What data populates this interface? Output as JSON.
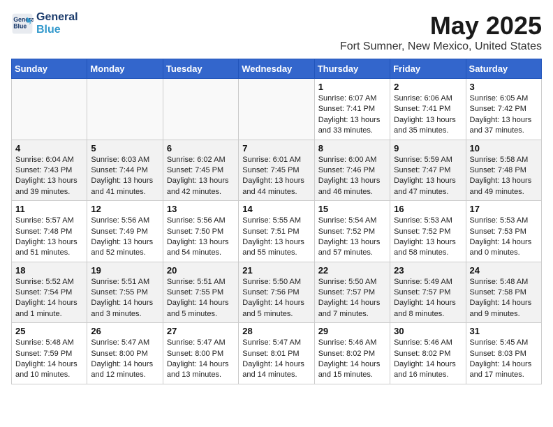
{
  "header": {
    "logo_line1": "General",
    "logo_line2": "Blue",
    "month": "May 2025",
    "location": "Fort Sumner, New Mexico, United States"
  },
  "weekdays": [
    "Sunday",
    "Monday",
    "Tuesday",
    "Wednesday",
    "Thursday",
    "Friday",
    "Saturday"
  ],
  "weeks": [
    [
      {
        "day": "",
        "info": ""
      },
      {
        "day": "",
        "info": ""
      },
      {
        "day": "",
        "info": ""
      },
      {
        "day": "",
        "info": ""
      },
      {
        "day": "1",
        "info": "Sunrise: 6:07 AM\nSunset: 7:41 PM\nDaylight: 13 hours\nand 33 minutes."
      },
      {
        "day": "2",
        "info": "Sunrise: 6:06 AM\nSunset: 7:41 PM\nDaylight: 13 hours\nand 35 minutes."
      },
      {
        "day": "3",
        "info": "Sunrise: 6:05 AM\nSunset: 7:42 PM\nDaylight: 13 hours\nand 37 minutes."
      }
    ],
    [
      {
        "day": "4",
        "info": "Sunrise: 6:04 AM\nSunset: 7:43 PM\nDaylight: 13 hours\nand 39 minutes."
      },
      {
        "day": "5",
        "info": "Sunrise: 6:03 AM\nSunset: 7:44 PM\nDaylight: 13 hours\nand 41 minutes."
      },
      {
        "day": "6",
        "info": "Sunrise: 6:02 AM\nSunset: 7:45 PM\nDaylight: 13 hours\nand 42 minutes."
      },
      {
        "day": "7",
        "info": "Sunrise: 6:01 AM\nSunset: 7:45 PM\nDaylight: 13 hours\nand 44 minutes."
      },
      {
        "day": "8",
        "info": "Sunrise: 6:00 AM\nSunset: 7:46 PM\nDaylight: 13 hours\nand 46 minutes."
      },
      {
        "day": "9",
        "info": "Sunrise: 5:59 AM\nSunset: 7:47 PM\nDaylight: 13 hours\nand 47 minutes."
      },
      {
        "day": "10",
        "info": "Sunrise: 5:58 AM\nSunset: 7:48 PM\nDaylight: 13 hours\nand 49 minutes."
      }
    ],
    [
      {
        "day": "11",
        "info": "Sunrise: 5:57 AM\nSunset: 7:48 PM\nDaylight: 13 hours\nand 51 minutes."
      },
      {
        "day": "12",
        "info": "Sunrise: 5:56 AM\nSunset: 7:49 PM\nDaylight: 13 hours\nand 52 minutes."
      },
      {
        "day": "13",
        "info": "Sunrise: 5:56 AM\nSunset: 7:50 PM\nDaylight: 13 hours\nand 54 minutes."
      },
      {
        "day": "14",
        "info": "Sunrise: 5:55 AM\nSunset: 7:51 PM\nDaylight: 13 hours\nand 55 minutes."
      },
      {
        "day": "15",
        "info": "Sunrise: 5:54 AM\nSunset: 7:52 PM\nDaylight: 13 hours\nand 57 minutes."
      },
      {
        "day": "16",
        "info": "Sunrise: 5:53 AM\nSunset: 7:52 PM\nDaylight: 13 hours\nand 58 minutes."
      },
      {
        "day": "17",
        "info": "Sunrise: 5:53 AM\nSunset: 7:53 PM\nDaylight: 14 hours\nand 0 minutes."
      }
    ],
    [
      {
        "day": "18",
        "info": "Sunrise: 5:52 AM\nSunset: 7:54 PM\nDaylight: 14 hours\nand 1 minute."
      },
      {
        "day": "19",
        "info": "Sunrise: 5:51 AM\nSunset: 7:55 PM\nDaylight: 14 hours\nand 3 minutes."
      },
      {
        "day": "20",
        "info": "Sunrise: 5:51 AM\nSunset: 7:55 PM\nDaylight: 14 hours\nand 5 minutes."
      },
      {
        "day": "21",
        "info": "Sunrise: 5:50 AM\nSunset: 7:56 PM\nDaylight: 14 hours\nand 5 minutes."
      },
      {
        "day": "22",
        "info": "Sunrise: 5:50 AM\nSunset: 7:57 PM\nDaylight: 14 hours\nand 7 minutes."
      },
      {
        "day": "23",
        "info": "Sunrise: 5:49 AM\nSunset: 7:57 PM\nDaylight: 14 hours\nand 8 minutes."
      },
      {
        "day": "24",
        "info": "Sunrise: 5:48 AM\nSunset: 7:58 PM\nDaylight: 14 hours\nand 9 minutes."
      }
    ],
    [
      {
        "day": "25",
        "info": "Sunrise: 5:48 AM\nSunset: 7:59 PM\nDaylight: 14 hours\nand 10 minutes."
      },
      {
        "day": "26",
        "info": "Sunrise: 5:47 AM\nSunset: 8:00 PM\nDaylight: 14 hours\nand 12 minutes."
      },
      {
        "day": "27",
        "info": "Sunrise: 5:47 AM\nSunset: 8:00 PM\nDaylight: 14 hours\nand 13 minutes."
      },
      {
        "day": "28",
        "info": "Sunrise: 5:47 AM\nSunset: 8:01 PM\nDaylight: 14 hours\nand 14 minutes."
      },
      {
        "day": "29",
        "info": "Sunrise: 5:46 AM\nSunset: 8:02 PM\nDaylight: 14 hours\nand 15 minutes."
      },
      {
        "day": "30",
        "info": "Sunrise: 5:46 AM\nSunset: 8:02 PM\nDaylight: 14 hours\nand 16 minutes."
      },
      {
        "day": "31",
        "info": "Sunrise: 5:45 AM\nSunset: 8:03 PM\nDaylight: 14 hours\nand 17 minutes."
      }
    ]
  ]
}
